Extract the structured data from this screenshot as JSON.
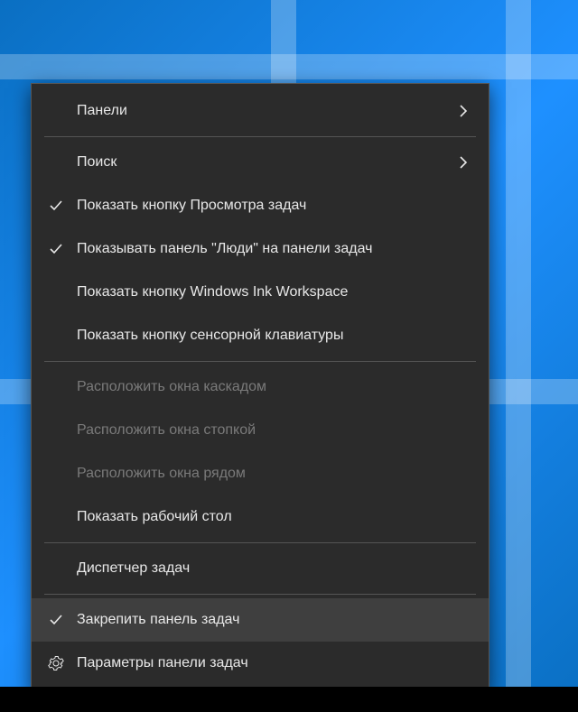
{
  "menu": {
    "groups": [
      [
        {
          "id": "toolbars",
          "label": "Панели",
          "submenu": true,
          "enabled": true
        }
      ],
      [
        {
          "id": "search",
          "label": "Поиск",
          "submenu": true,
          "enabled": true
        },
        {
          "id": "show-task-view",
          "label": "Показать кнопку Просмотра задач",
          "checked": true,
          "enabled": true
        },
        {
          "id": "show-people",
          "label": "Показывать панель \"Люди\" на панели задач",
          "checked": true,
          "enabled": true
        },
        {
          "id": "show-ink",
          "label": "Показать кнопку Windows Ink Workspace",
          "enabled": true
        },
        {
          "id": "show-touch-kb",
          "label": "Показать кнопку сенсорной клавиатуры",
          "enabled": true
        }
      ],
      [
        {
          "id": "cascade",
          "label": "Расположить окна каскадом",
          "enabled": false
        },
        {
          "id": "stack",
          "label": "Расположить окна стопкой",
          "enabled": false
        },
        {
          "id": "side-by-side",
          "label": "Расположить окна рядом",
          "enabled": false
        },
        {
          "id": "show-desktop",
          "label": "Показать рабочий стол",
          "enabled": true
        }
      ],
      [
        {
          "id": "task-manager",
          "label": "Диспетчер задач",
          "enabled": true
        }
      ],
      [
        {
          "id": "lock-taskbar",
          "label": "Закрепить панель задач",
          "checked": true,
          "enabled": true,
          "hover": true
        },
        {
          "id": "taskbar-settings",
          "label": "Параметры панели задач",
          "icon": "gear",
          "enabled": true
        }
      ]
    ]
  }
}
